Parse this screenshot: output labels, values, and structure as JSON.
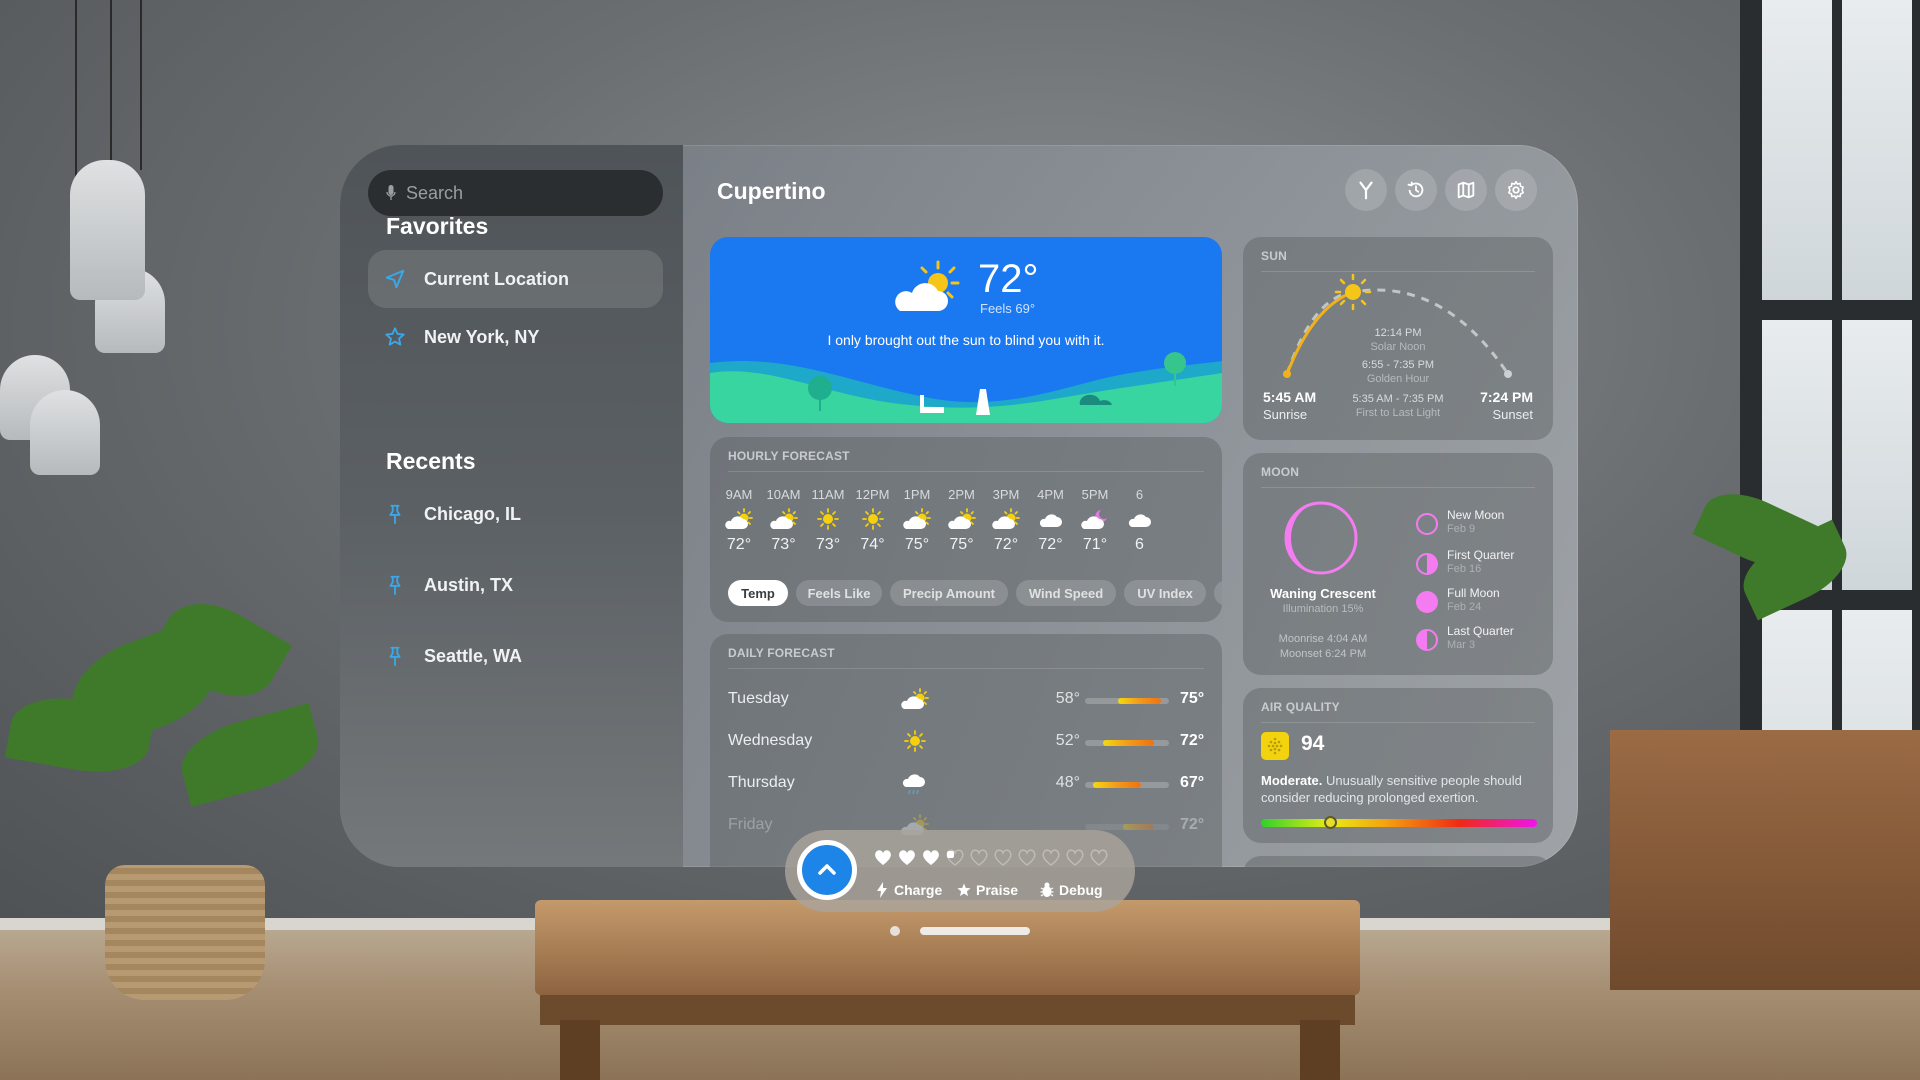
{
  "sidebar": {
    "search": {
      "placeholder": "Search",
      "value": ""
    },
    "favorites_title": "Favorites",
    "favorites": [
      {
        "label": "Current Location",
        "icon": "location-arrow-icon",
        "selected": true
      },
      {
        "label": "New York, NY",
        "icon": "star-icon",
        "selected": false
      }
    ],
    "recents_title": "Recents",
    "recents": [
      {
        "label": "Chicago, IL",
        "icon": "pin-icon"
      },
      {
        "label": "Austin, TX",
        "icon": "pin-icon"
      },
      {
        "label": "Seattle, WA",
        "icon": "pin-icon"
      }
    ]
  },
  "header": {
    "title": "Cupertino",
    "toolbar": [
      "fork-icon",
      "history-icon",
      "map-icon",
      "gear-icon"
    ]
  },
  "current": {
    "temp": "72°",
    "feels": "Feels 69°",
    "quote": "I only brought out the sun to blind you with it.",
    "icon": "partly-sunny-icon"
  },
  "hourly": {
    "title": "HOURLY FORECAST",
    "hours": [
      {
        "time": "9AM",
        "temp": "72°",
        "icon": "partly-sunny"
      },
      {
        "time": "10AM",
        "temp": "73°",
        "icon": "partly-sunny"
      },
      {
        "time": "11AM",
        "temp": "73°",
        "icon": "sunny"
      },
      {
        "time": "12PM",
        "temp": "74°",
        "icon": "sunny"
      },
      {
        "time": "1PM",
        "temp": "75°",
        "icon": "partly-sunny"
      },
      {
        "time": "2PM",
        "temp": "75°",
        "icon": "partly-sunny"
      },
      {
        "time": "3PM",
        "temp": "72°",
        "icon": "partly-sunny"
      },
      {
        "time": "4PM",
        "temp": "72°",
        "icon": "cloudy"
      },
      {
        "time": "5PM",
        "temp": "71°",
        "icon": "partly-cloudy-night"
      },
      {
        "time": "6",
        "temp": "6",
        "icon": "cloudy"
      }
    ],
    "metrics": [
      "Temp",
      "Feels Like",
      "Precip Amount",
      "Wind Speed",
      "UV Index"
    ],
    "selected_metric": "Temp"
  },
  "daily": {
    "title": "DAILY FORECAST",
    "range": {
      "min": 45,
      "max": 78
    },
    "days": [
      {
        "day": "Tuesday",
        "low": "58°",
        "high": "75°",
        "low_val": 58,
        "high_val": 75,
        "icon": "partly-sunny"
      },
      {
        "day": "Wednesday",
        "low": "52°",
        "high": "72°",
        "low_val": 52,
        "high_val": 72,
        "icon": "sunny"
      },
      {
        "day": "Thursday",
        "low": "48°",
        "high": "67°",
        "low_val": 48,
        "high_val": 67,
        "icon": "rain"
      },
      {
        "day": "Friday",
        "low": "",
        "high": "72°",
        "low_val": 60,
        "high_val": 72,
        "icon": "partly-sunny"
      }
    ]
  },
  "sun": {
    "title": "SUN",
    "sunrise_time": "5:45 AM",
    "sunrise_label": "Sunrise",
    "sunset_time": "7:24 PM",
    "sunset_label": "Sunset",
    "solar_noon": "12:14 PM",
    "solar_noon_label": "Solar Noon",
    "golden_hour": "6:55 - 7:35 PM",
    "golden_hour_label": "Golden Hour",
    "first_last_light": "5:35 AM - 7:35 PM",
    "first_last_light_label": "First to Last Light",
    "day_progress": 0.45
  },
  "moon": {
    "title": "MOON",
    "phase": "Waning Crescent",
    "illumination": "Illumination 15%",
    "moonrise": "Moonrise 4:04 AM",
    "moonset": "Moonset 6:24 PM",
    "upcoming": [
      {
        "name": "New Moon",
        "date": "Feb 9",
        "icon": "new-moon-icon"
      },
      {
        "name": "First Quarter",
        "date": "Feb 16",
        "icon": "first-quarter-icon"
      },
      {
        "name": "Full Moon",
        "date": "Feb 24",
        "icon": "full-moon-icon"
      },
      {
        "name": "Last Quarter",
        "date": "Mar 3",
        "icon": "last-quarter-icon"
      }
    ],
    "accent": "#f47cf0"
  },
  "air_quality": {
    "title": "AIR QUALITY",
    "value": "94",
    "level": "Moderate.",
    "description": "Unusually sensitive people should consider reducing prolonged exertion.",
    "scale_position": 0.23,
    "badge_color": "#f2d30d"
  },
  "ornament": {
    "hearts_total": 10,
    "hearts_filled": 3.5,
    "actions": [
      {
        "label": "Charge",
        "icon": "bolt-icon"
      },
      {
        "label": "Praise",
        "icon": "star-icon"
      },
      {
        "label": "Debug",
        "icon": "bug-icon"
      }
    ]
  },
  "colors": {
    "accent_blue": "#3aa7e8",
    "hero_blue": "#1a78f0",
    "sun_yellow": "#f5c518"
  }
}
